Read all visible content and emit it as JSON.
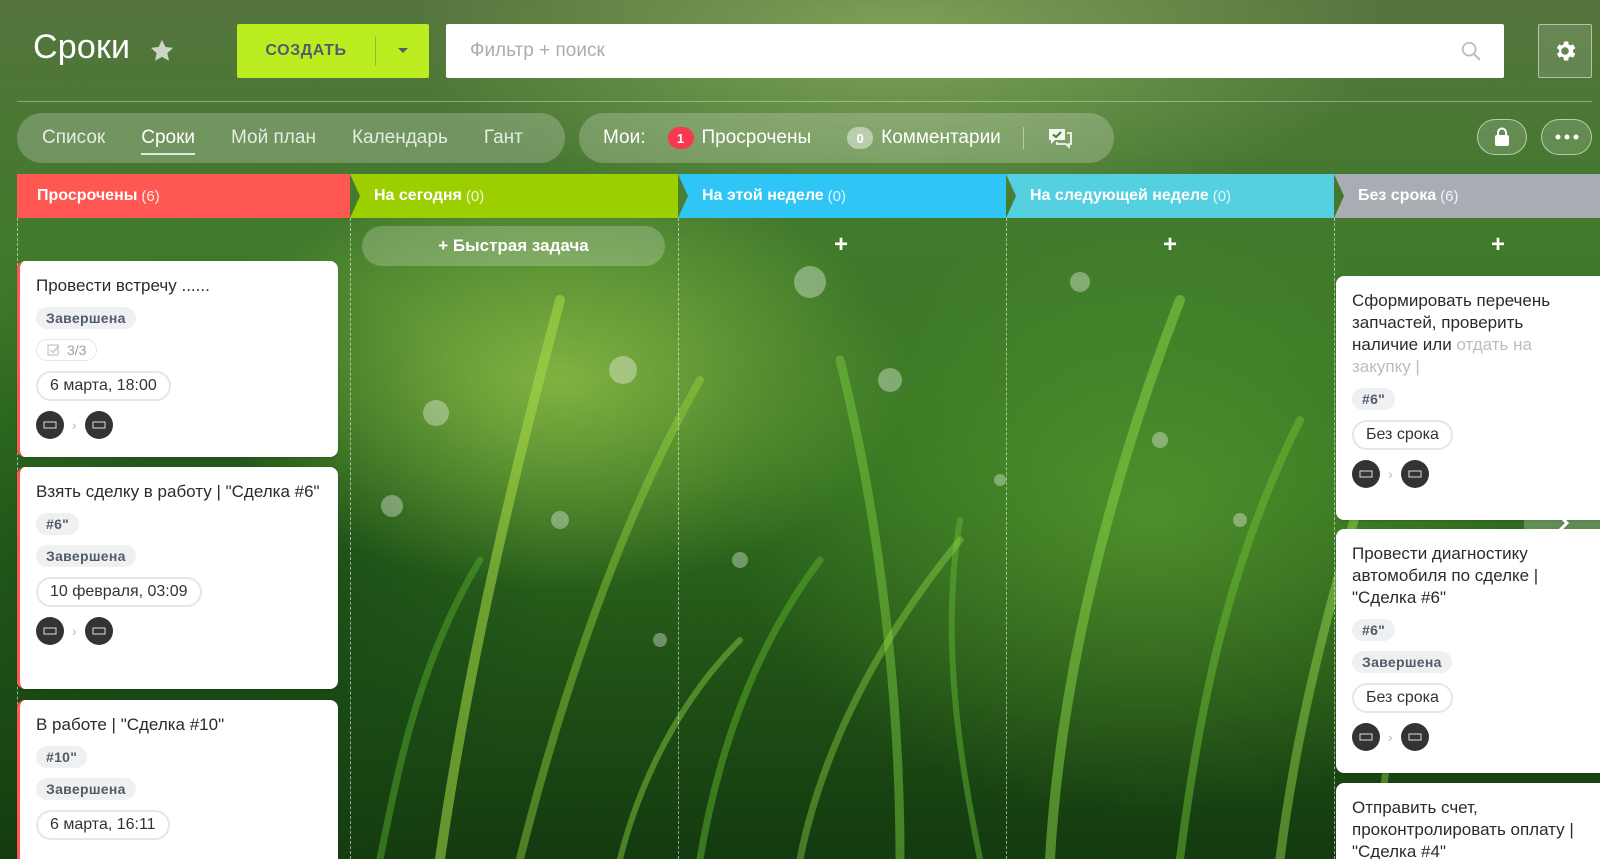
{
  "header": {
    "title": "Сроки",
    "create_label": "СОЗДАТЬ",
    "search_placeholder": "Фильтр + поиск"
  },
  "tabs": [
    {
      "label": "Список",
      "active": false
    },
    {
      "label": "Сроки",
      "active": true
    },
    {
      "label": "Мой план",
      "active": false
    },
    {
      "label": "Календарь",
      "active": false
    },
    {
      "label": "Гант",
      "active": false
    }
  ],
  "counters": {
    "mine_label": "Мои:",
    "overdue_count": "1",
    "overdue_label": "Просрочены",
    "comments_count": "0",
    "comments_label": "Комментарии"
  },
  "columns": [
    {
      "title": "Просрочены",
      "count": "(6)",
      "color": "#ff5752"
    },
    {
      "title": "На сегодня",
      "count": "(0)",
      "color": "#9dcf00"
    },
    {
      "title": "На этой неделе",
      "count": "(0)",
      "color": "#2fc6f6"
    },
    {
      "title": "На следующей неделе",
      "count": "(0)",
      "color": "#55d0e0"
    },
    {
      "title": "Без срока",
      "count": "(6)",
      "color": "#a8adb4"
    }
  ],
  "quick_task_label": "+ Быстрая задача",
  "overdue_cards": [
    {
      "title": "Провести встречу ......",
      "status": "Завершена",
      "checklist": "3/3",
      "date": "6 марта, 18:00"
    },
    {
      "title": "Взять сделку в работу | \"Сделка #6\"",
      "tag": "#6\"",
      "status": "Завершена",
      "date": "10 февраля, 03:09"
    },
    {
      "title": "В работе | \"Сделка #10\"",
      "tag": "#10\"",
      "status": "Завершена",
      "date": "6 марта, 16:11"
    }
  ],
  "nodeadline_cards": [
    {
      "title_main": "Сформировать перечень запчастей, проверить наличие или",
      "title_fade": "отдать на закупку |",
      "tag": "#6\"",
      "date": "Без срока"
    },
    {
      "title": "Провести диагностику автомобиля по сделке | \"Сделка #6\"",
      "tag": "#6\"",
      "status": "Завершена",
      "date": "Без срока"
    },
    {
      "title": "Отправить счет, проконтролировать оплату | \"Сделка #4\""
    }
  ],
  "colors": {
    "accent_green": "#bbed21",
    "overdue_red": "#ff5752",
    "badge_red": "#f9394f"
  }
}
